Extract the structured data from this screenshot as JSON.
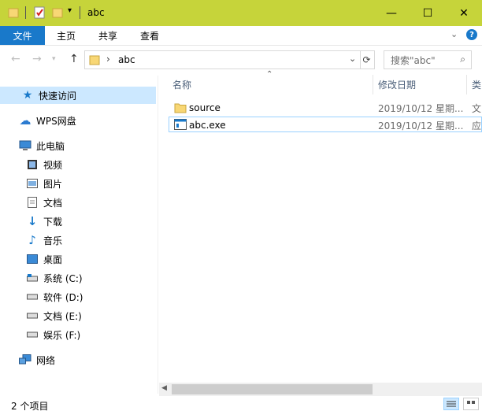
{
  "window": {
    "title": "abc",
    "controls": {
      "minimize": "—",
      "maximize": "☐",
      "close": "✕"
    }
  },
  "ribbon": {
    "tabs": [
      {
        "label": "文件",
        "active": true
      },
      {
        "label": "主页"
      },
      {
        "label": "共享"
      },
      {
        "label": "查看"
      }
    ],
    "expand_icon": "chevron-down-icon",
    "help_label": "?"
  },
  "address": {
    "path_separator": "›",
    "current": "abc",
    "search_placeholder": "搜索\"abc\""
  },
  "nav": {
    "quick_access": "快速访问",
    "wps_drive": "WPS网盘",
    "this_pc": "此电脑",
    "folders": [
      "视频",
      "图片",
      "文档",
      "下载",
      "音乐",
      "桌面"
    ],
    "drives": [
      "系统 (C:)",
      "软件 (D:)",
      "文档 (E:)",
      "娱乐 (F:)"
    ],
    "network": "网络"
  },
  "columns": {
    "name": "名称",
    "modified": "修改日期",
    "type": "类"
  },
  "files": [
    {
      "name": "source",
      "modified": "2019/10/12 星期...",
      "type": "文",
      "kind": "folder"
    },
    {
      "name": "abc.exe",
      "modified": "2019/10/12 星期...",
      "type": "应",
      "kind": "exe"
    }
  ],
  "status": {
    "count": "2 个项目"
  },
  "colors": {
    "accent": "#1979ca",
    "titlebar": "#c6d43a",
    "selection": "#cce8ff",
    "folder": "#f8d775"
  }
}
